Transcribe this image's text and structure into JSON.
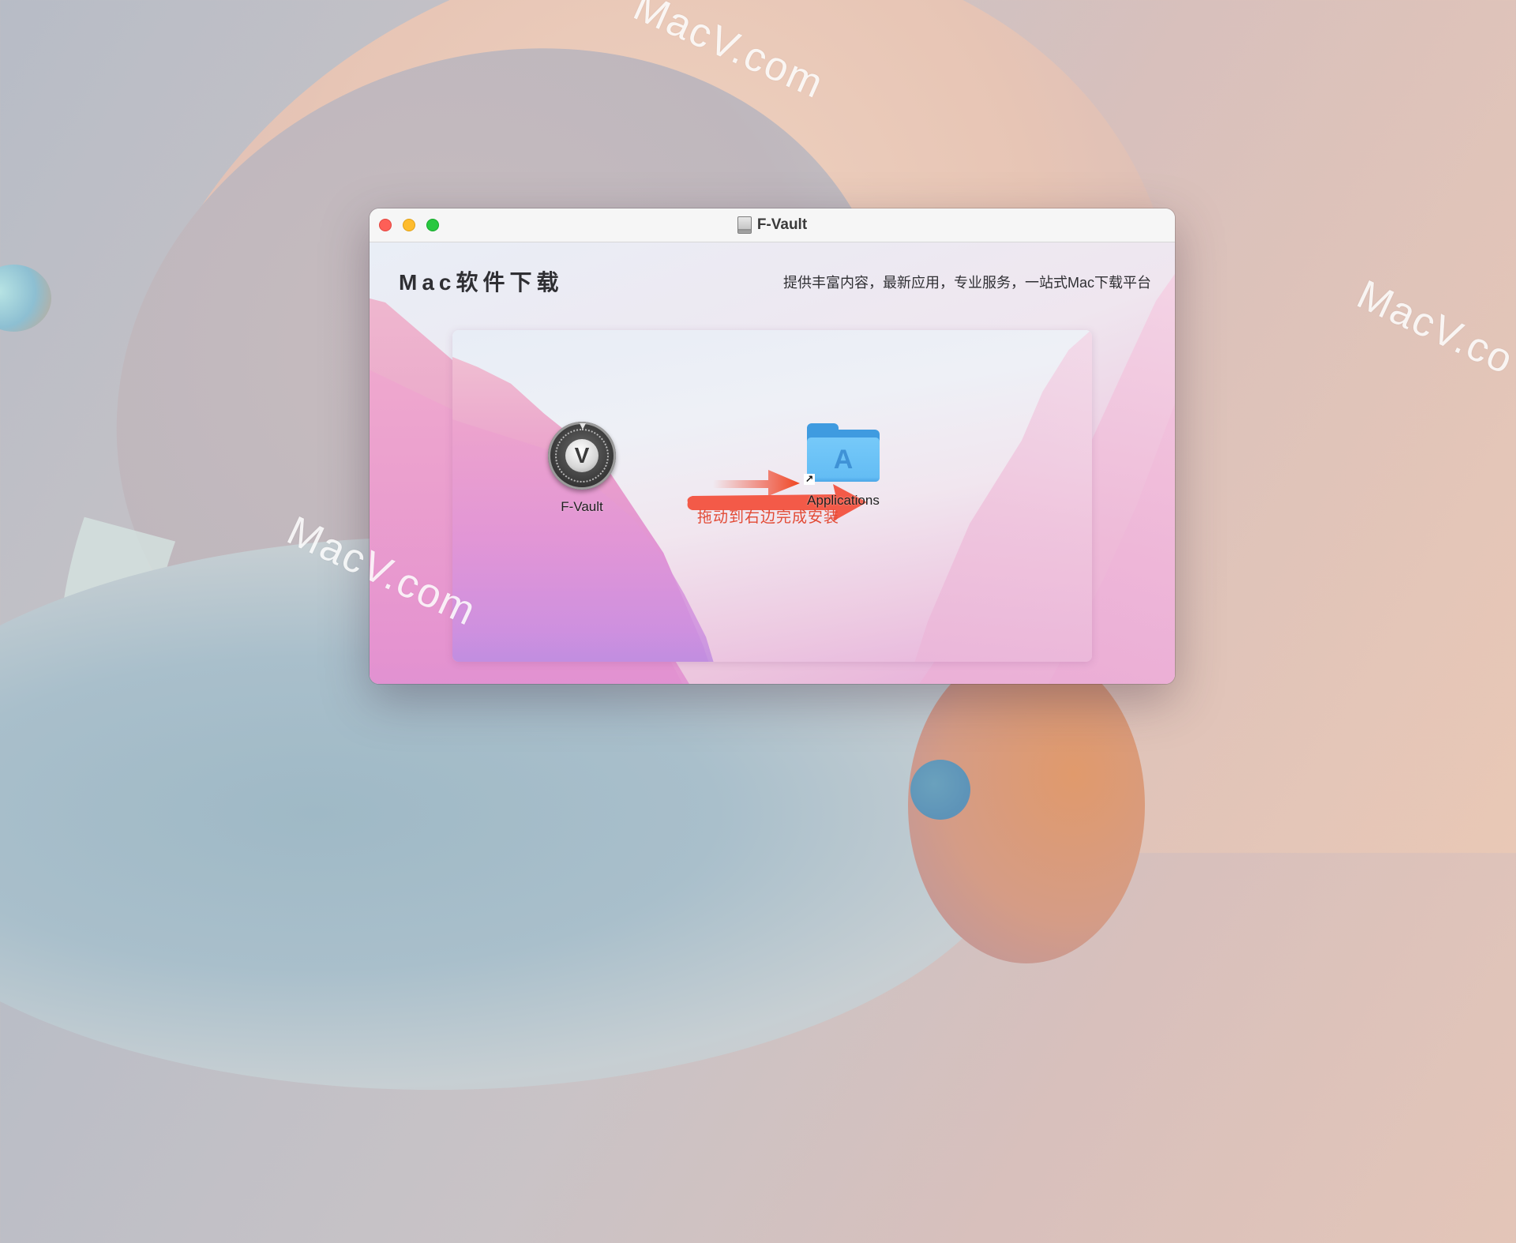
{
  "desktop": {
    "watermarks": [
      "MacV.com",
      "MacV.com",
      "MacV.co"
    ]
  },
  "window": {
    "title": "F-Vault",
    "title_icon": "disk-image-icon",
    "traffic_lights": {
      "close": {
        "label": "close",
        "color": "#fe5f57"
      },
      "minimize": {
        "label": "minimize",
        "color": "#febc2e"
      },
      "zoom": {
        "label": "zoom",
        "color": "#28c840"
      }
    }
  },
  "installer": {
    "brand": "Mac软件下载",
    "tagline": "提供丰富内容，最新应用，专业服务，一站式Mac下载平台",
    "source_item": {
      "label": "F-Vault",
      "icon": "vault-lock-icon",
      "glyph": "V"
    },
    "target_item": {
      "label": "Applications",
      "icon": "applications-folder-icon",
      "glyph": "A",
      "alias_glyph": "↗"
    },
    "instruction": "拖动到右边完成安装",
    "accent_color": "#f05a45"
  }
}
